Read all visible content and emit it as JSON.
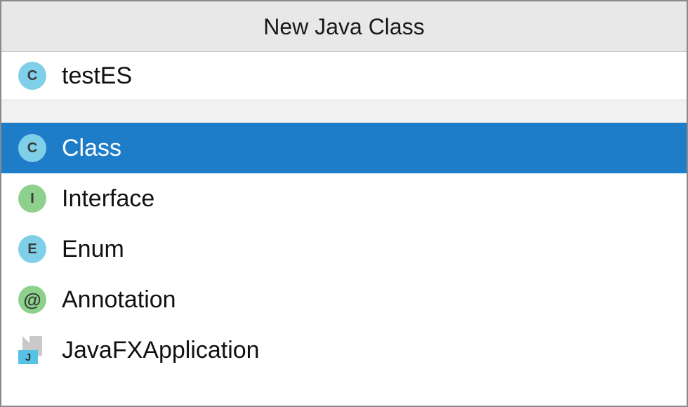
{
  "dialog": {
    "title": "New Java Class",
    "input_value": "testES",
    "input_icon_letter": "C"
  },
  "kinds": [
    {
      "id": "class",
      "label": "Class",
      "icon": "c-badge",
      "letter": "C",
      "color": "blue",
      "selected": true
    },
    {
      "id": "interface",
      "label": "Interface",
      "icon": "i-badge",
      "letter": "I",
      "color": "green",
      "selected": false
    },
    {
      "id": "enum",
      "label": "Enum",
      "icon": "e-badge",
      "letter": "E",
      "color": "blue",
      "selected": false
    },
    {
      "id": "annotation",
      "label": "Annotation",
      "icon": "at-badge",
      "letter": "@",
      "color": "green",
      "selected": false
    },
    {
      "id": "javafx",
      "label": "JavaFXApplication",
      "icon": "j-file",
      "letter": "J",
      "color": "blue",
      "selected": false
    }
  ]
}
